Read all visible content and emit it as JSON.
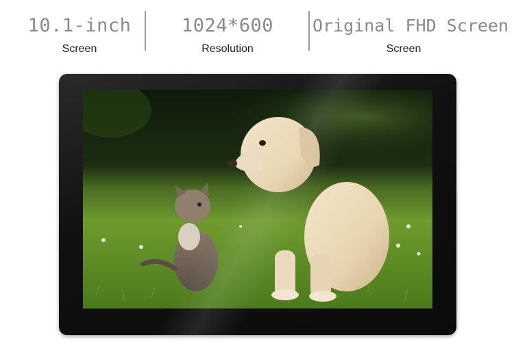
{
  "specs": [
    {
      "value": "10.1-inch",
      "label": "Screen"
    },
    {
      "value": "1024*600",
      "label": "Resolution"
    },
    {
      "value": "Original FHD Screen",
      "label": "Screen"
    }
  ],
  "product": {
    "screen_image": "puppy-and-kitten-photo",
    "bezel_color": "#111111"
  }
}
